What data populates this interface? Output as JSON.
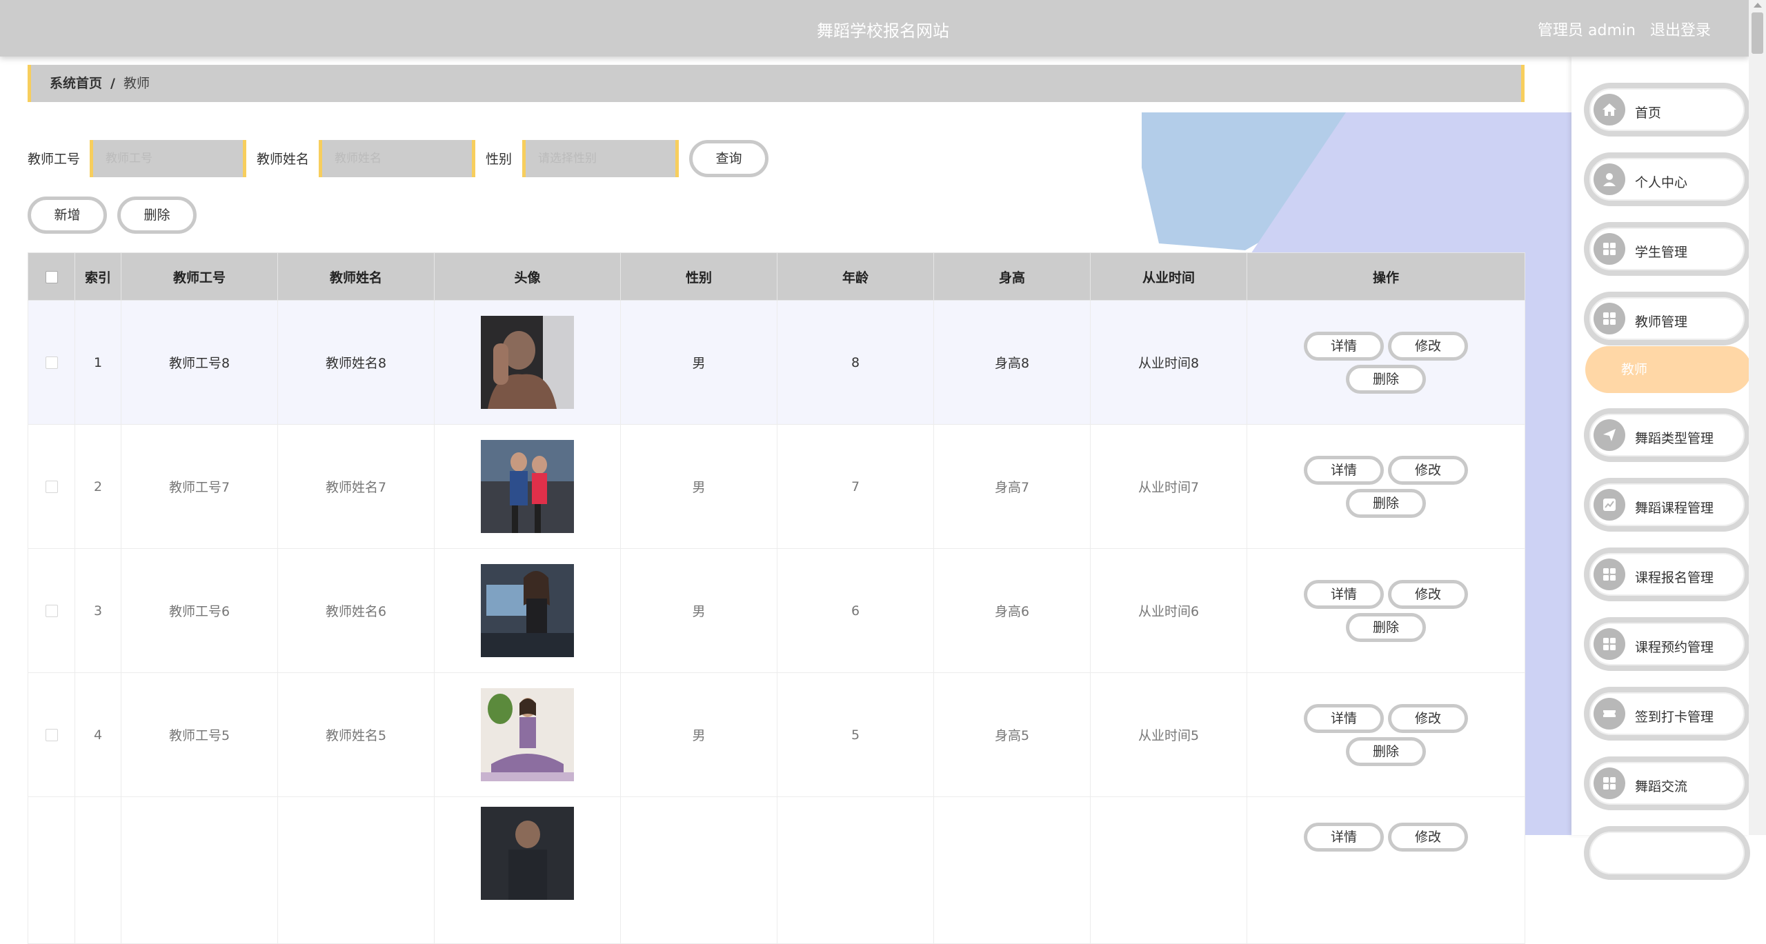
{
  "header": {
    "title": "舞蹈学校报名网站",
    "user_label": "管理员 admin",
    "logout": "退出登录"
  },
  "breadcrumb": {
    "home": "系统首页",
    "separator": "/",
    "current": "教师"
  },
  "search": {
    "fields": [
      {
        "label": "教师工号",
        "placeholder": "教师工号"
      },
      {
        "label": "教师姓名",
        "placeholder": "教师姓名"
      },
      {
        "label": "性别",
        "placeholder": "请选择性别"
      }
    ],
    "query_button": "查询"
  },
  "actions": {
    "add": "新增",
    "delete": "删除"
  },
  "table": {
    "columns": [
      "索引",
      "教师工号",
      "教师姓名",
      "头像",
      "性别",
      "年龄",
      "身高",
      "从业时间",
      "操作"
    ],
    "rows": [
      {
        "index": "1",
        "id": "教师工号8",
        "name": "教师姓名8",
        "gender": "男",
        "age": "8",
        "height": "身高8",
        "years": "从业时间8"
      },
      {
        "index": "2",
        "id": "教师工号7",
        "name": "教师姓名7",
        "gender": "男",
        "age": "7",
        "height": "身高7",
        "years": "从业时间7"
      },
      {
        "index": "3",
        "id": "教师工号6",
        "name": "教师姓名6",
        "gender": "男",
        "age": "6",
        "height": "身高6",
        "years": "从业时间6"
      },
      {
        "index": "4",
        "id": "教师工号5",
        "name": "教师姓名5",
        "gender": "男",
        "age": "5",
        "height": "身高5",
        "years": "从业时间5"
      },
      {
        "index": "",
        "id": "",
        "name": "",
        "gender": "",
        "age": "",
        "height": "",
        "years": ""
      }
    ],
    "row_actions": {
      "detail": "详情",
      "edit": "修改",
      "delete": "删除"
    }
  },
  "sidebar": {
    "items": [
      {
        "label": "首页",
        "icon": "home-icon"
      },
      {
        "label": "个人中心",
        "icon": "user-icon"
      },
      {
        "label": "学生管理",
        "icon": "grid-icon"
      },
      {
        "label": "教师管理",
        "icon": "grid-icon"
      },
      {
        "label": "舞蹈类型管理",
        "icon": "send-icon"
      },
      {
        "label": "舞蹈课程管理",
        "icon": "chart-icon"
      },
      {
        "label": "课程报名管理",
        "icon": "grid-icon"
      },
      {
        "label": "课程预约管理",
        "icon": "grid-icon"
      },
      {
        "label": "签到打卡管理",
        "icon": "ticket-icon"
      },
      {
        "label": "舞蹈交流",
        "icon": "grid-icon"
      }
    ],
    "active_sub": "教师"
  },
  "colors": {
    "accent": "#f7ce5d",
    "header_bg": "#cccccc",
    "active_sub": "#ffd7a6"
  }
}
